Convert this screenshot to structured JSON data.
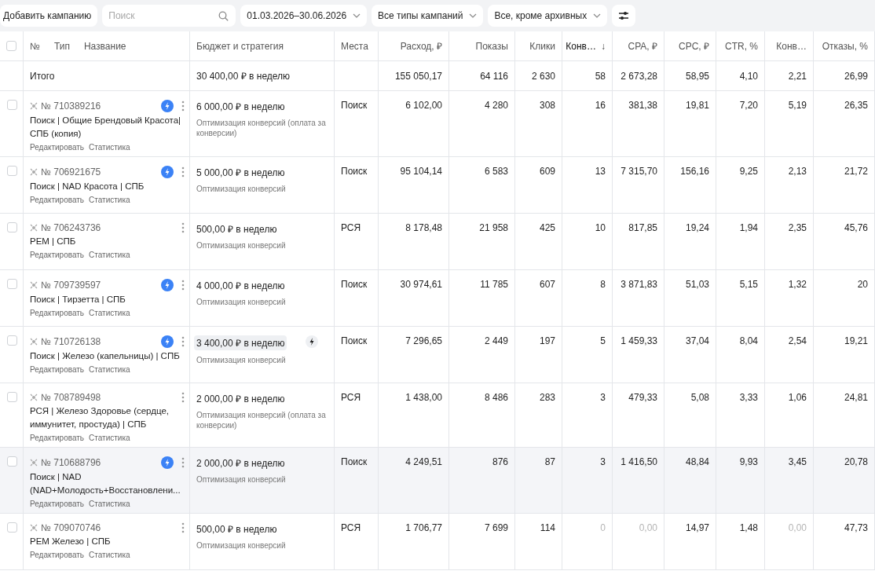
{
  "toolbar": {
    "add_button": "Добавить кампанию",
    "search": {
      "placeholder": "Поиск"
    },
    "filters": [
      {
        "label": "01.03.2026–30.06.2026"
      },
      {
        "label": "Все типы кампаний"
      },
      {
        "label": "Все, кроме архивных"
      }
    ]
  },
  "table": {
    "header_checkbox": {
      "checked": false
    },
    "name_header": [
      "№",
      "Тип",
      "Название"
    ],
    "columns": [
      {
        "label": "Бюджет и стратегия",
        "sorted": false
      },
      {
        "label": "Места",
        "sorted": false
      },
      {
        "label": "Расход, ₽",
        "sorted": false
      },
      {
        "label": "Показы",
        "sorted": false
      },
      {
        "label": "Клики",
        "sorted": false
      },
      {
        "label": "Конв…",
        "sorted": true,
        "sort_indicator": "↓"
      },
      {
        "label": "CPA, ₽",
        "sorted": false
      },
      {
        "label": "CPC, ₽",
        "sorted": false
      },
      {
        "label": "CTR, %",
        "sorted": false
      },
      {
        "label": "Конв…",
        "sorted": false
      },
      {
        "label": "Отказы, %",
        "sorted": false
      }
    ],
    "total": {
      "label": "Итого",
      "budget": "30 400,00 ₽ в неделю",
      "values": [
        "155 050,17",
        "64 116",
        "2 630",
        "58",
        "2 673,28",
        "58,95",
        "4,10",
        "2,21",
        "26,99"
      ]
    },
    "rows": [
      {
        "checked": false,
        "highlighted": false,
        "number": "№ 710389216",
        "name": "Поиск | Общие Брендовый Красота| СПБ (копия)",
        "autotarget": true,
        "edit_link": "Редактировать",
        "stats_link": "Статистика",
        "budget": "6 000,00 ₽ в неделю",
        "budget_edited": false,
        "strategy": "Оптимизация конверсий (оплата за конверсии)",
        "places": "Поиск",
        "values": [
          "6 102,00",
          "4 280",
          "308",
          "16",
          "381,38",
          "19,81",
          "7,20",
          "5,19",
          "26,35"
        ],
        "no_conversions": false
      },
      {
        "checked": false,
        "highlighted": false,
        "number": "№ 706921675",
        "name": "Поиск | NAD Красота | СПБ",
        "autotarget": true,
        "edit_link": "Редактировать",
        "stats_link": "Статистика",
        "budget": "5 000,00 ₽ в неделю",
        "budget_edited": false,
        "strategy": "Оптимизация конверсий",
        "places": "Поиск",
        "values": [
          "95 104,14",
          "6 583",
          "609",
          "13",
          "7 315,70",
          "156,16",
          "9,25",
          "2,13",
          "21,72"
        ],
        "no_conversions": false
      },
      {
        "checked": false,
        "highlighted": false,
        "number": "№ 706243736",
        "name": "РЕМ | СПБ",
        "autotarget": false,
        "edit_link": "Редактировать",
        "stats_link": "Статистика",
        "budget": "500,00 ₽ в неделю",
        "budget_edited": false,
        "strategy": "Оптимизация конверсий",
        "places": "РСЯ",
        "values": [
          "8 178,48",
          "21 958",
          "425",
          "10",
          "817,85",
          "19,24",
          "1,94",
          "2,35",
          "45,76"
        ],
        "no_conversions": false
      },
      {
        "checked": false,
        "highlighted": false,
        "number": "№ 709739597",
        "name": "Поиск | Тирзетта | СПБ",
        "autotarget": true,
        "edit_link": "Редактировать",
        "stats_link": "Статистика",
        "budget": "4 000,00 ₽ в неделю",
        "budget_edited": false,
        "strategy": "Оптимизация конверсий",
        "places": "Поиск",
        "values": [
          "30 974,61",
          "11 785",
          "607",
          "8",
          "3 871,83",
          "51,03",
          "5,15",
          "1,32",
          "20"
        ],
        "no_conversions": false
      },
      {
        "checked": false,
        "highlighted": false,
        "number": "№ 710726138",
        "name": "Поиск | Железо (капельницы) | СПБ",
        "autotarget": true,
        "edit_link": "Редактировать",
        "stats_link": "Статистика",
        "budget": "3 400,00 ₽ в неделю",
        "budget_edited": true,
        "strategy": "Оптимизация конверсий",
        "places": "Поиск",
        "values": [
          "7 296,65",
          "2 449",
          "197",
          "5",
          "1 459,33",
          "37,04",
          "8,04",
          "2,54",
          "19,21"
        ],
        "no_conversions": false
      },
      {
        "checked": false,
        "highlighted": false,
        "number": "№ 708789498",
        "name": "РСЯ | Железо Здоровье (сердце, иммунитет, простуда) | СПБ",
        "autotarget": false,
        "edit_link": "Редактировать",
        "stats_link": "Статистика",
        "budget": "2 000,00 ₽ в неделю",
        "budget_edited": false,
        "strategy": "Оптимизация конверсий (оплата за конверсии)",
        "places": "РСЯ",
        "values": [
          "1 438,00",
          "8 486",
          "283",
          "3",
          "479,33",
          "5,08",
          "3,33",
          "1,06",
          "24,81"
        ],
        "no_conversions": false
      },
      {
        "checked": false,
        "highlighted": true,
        "number": "№ 710688796",
        "name": "Поиск | NAD (NAD+Молодость+Восстановлени...",
        "autotarget": true,
        "edit_link": "Редактировать",
        "stats_link": "Статистика",
        "budget": "2 000,00 ₽ в неделю",
        "budget_edited": false,
        "strategy": "Оптимизация конверсий",
        "places": "Поиск",
        "values": [
          "4 249,51",
          "876",
          "87",
          "3",
          "1 416,50",
          "48,84",
          "9,93",
          "3,45",
          "20,78"
        ],
        "no_conversions": false
      },
      {
        "checked": false,
        "highlighted": false,
        "number": "№ 709070746",
        "name": "РЕМ Железо | СПБ",
        "autotarget": false,
        "edit_link": "Редактировать",
        "stats_link": "Статистика",
        "budget": "500,00 ₽ в неделю",
        "budget_edited": false,
        "strategy": "Оптимизация конверсий",
        "places": "РСЯ",
        "values": [
          "1 706,77",
          "7 699",
          "114",
          "0",
          "0,00",
          "14,97",
          "1,48",
          "0,00",
          "47,73"
        ],
        "no_conversions": true
      }
    ]
  }
}
